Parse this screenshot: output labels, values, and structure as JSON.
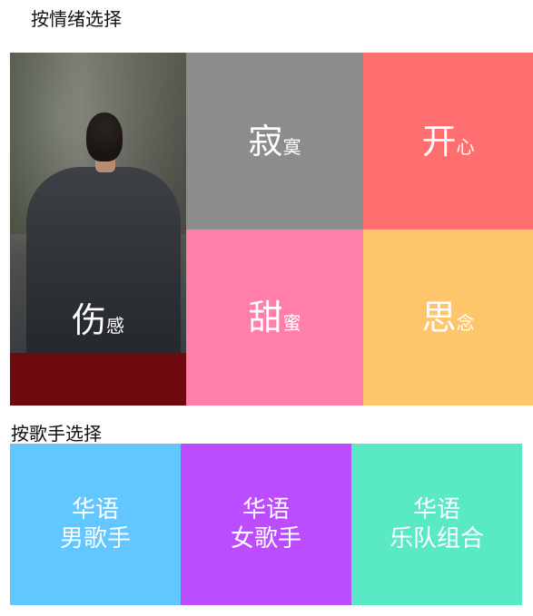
{
  "mood_section": {
    "title": "按情绪选择",
    "tiles": [
      {
        "id": "sad",
        "big": "伤",
        "small": "感"
      },
      {
        "id": "lonely",
        "big": "寂",
        "small": "寞",
        "color": "#8c8c8c"
      },
      {
        "id": "happy",
        "big": "开",
        "small": "心",
        "color": "#ff6f6f"
      },
      {
        "id": "sweet",
        "big": "甜",
        "small": "蜜",
        "color": "#ff7fa8"
      },
      {
        "id": "missing",
        "big": "思",
        "small": "念",
        "color": "#ffc56b"
      }
    ]
  },
  "singer_section": {
    "title": "按歌手选择",
    "tiles": [
      {
        "id": "male",
        "line1": "华语",
        "line2": "男歌手",
        "color": "#62c7ff"
      },
      {
        "id": "female",
        "line1": "华语",
        "line2": "女歌手",
        "color": "#bb4cff"
      },
      {
        "id": "band",
        "line1": "华语",
        "line2": "乐队组合",
        "color": "#5ae9c5"
      }
    ]
  }
}
